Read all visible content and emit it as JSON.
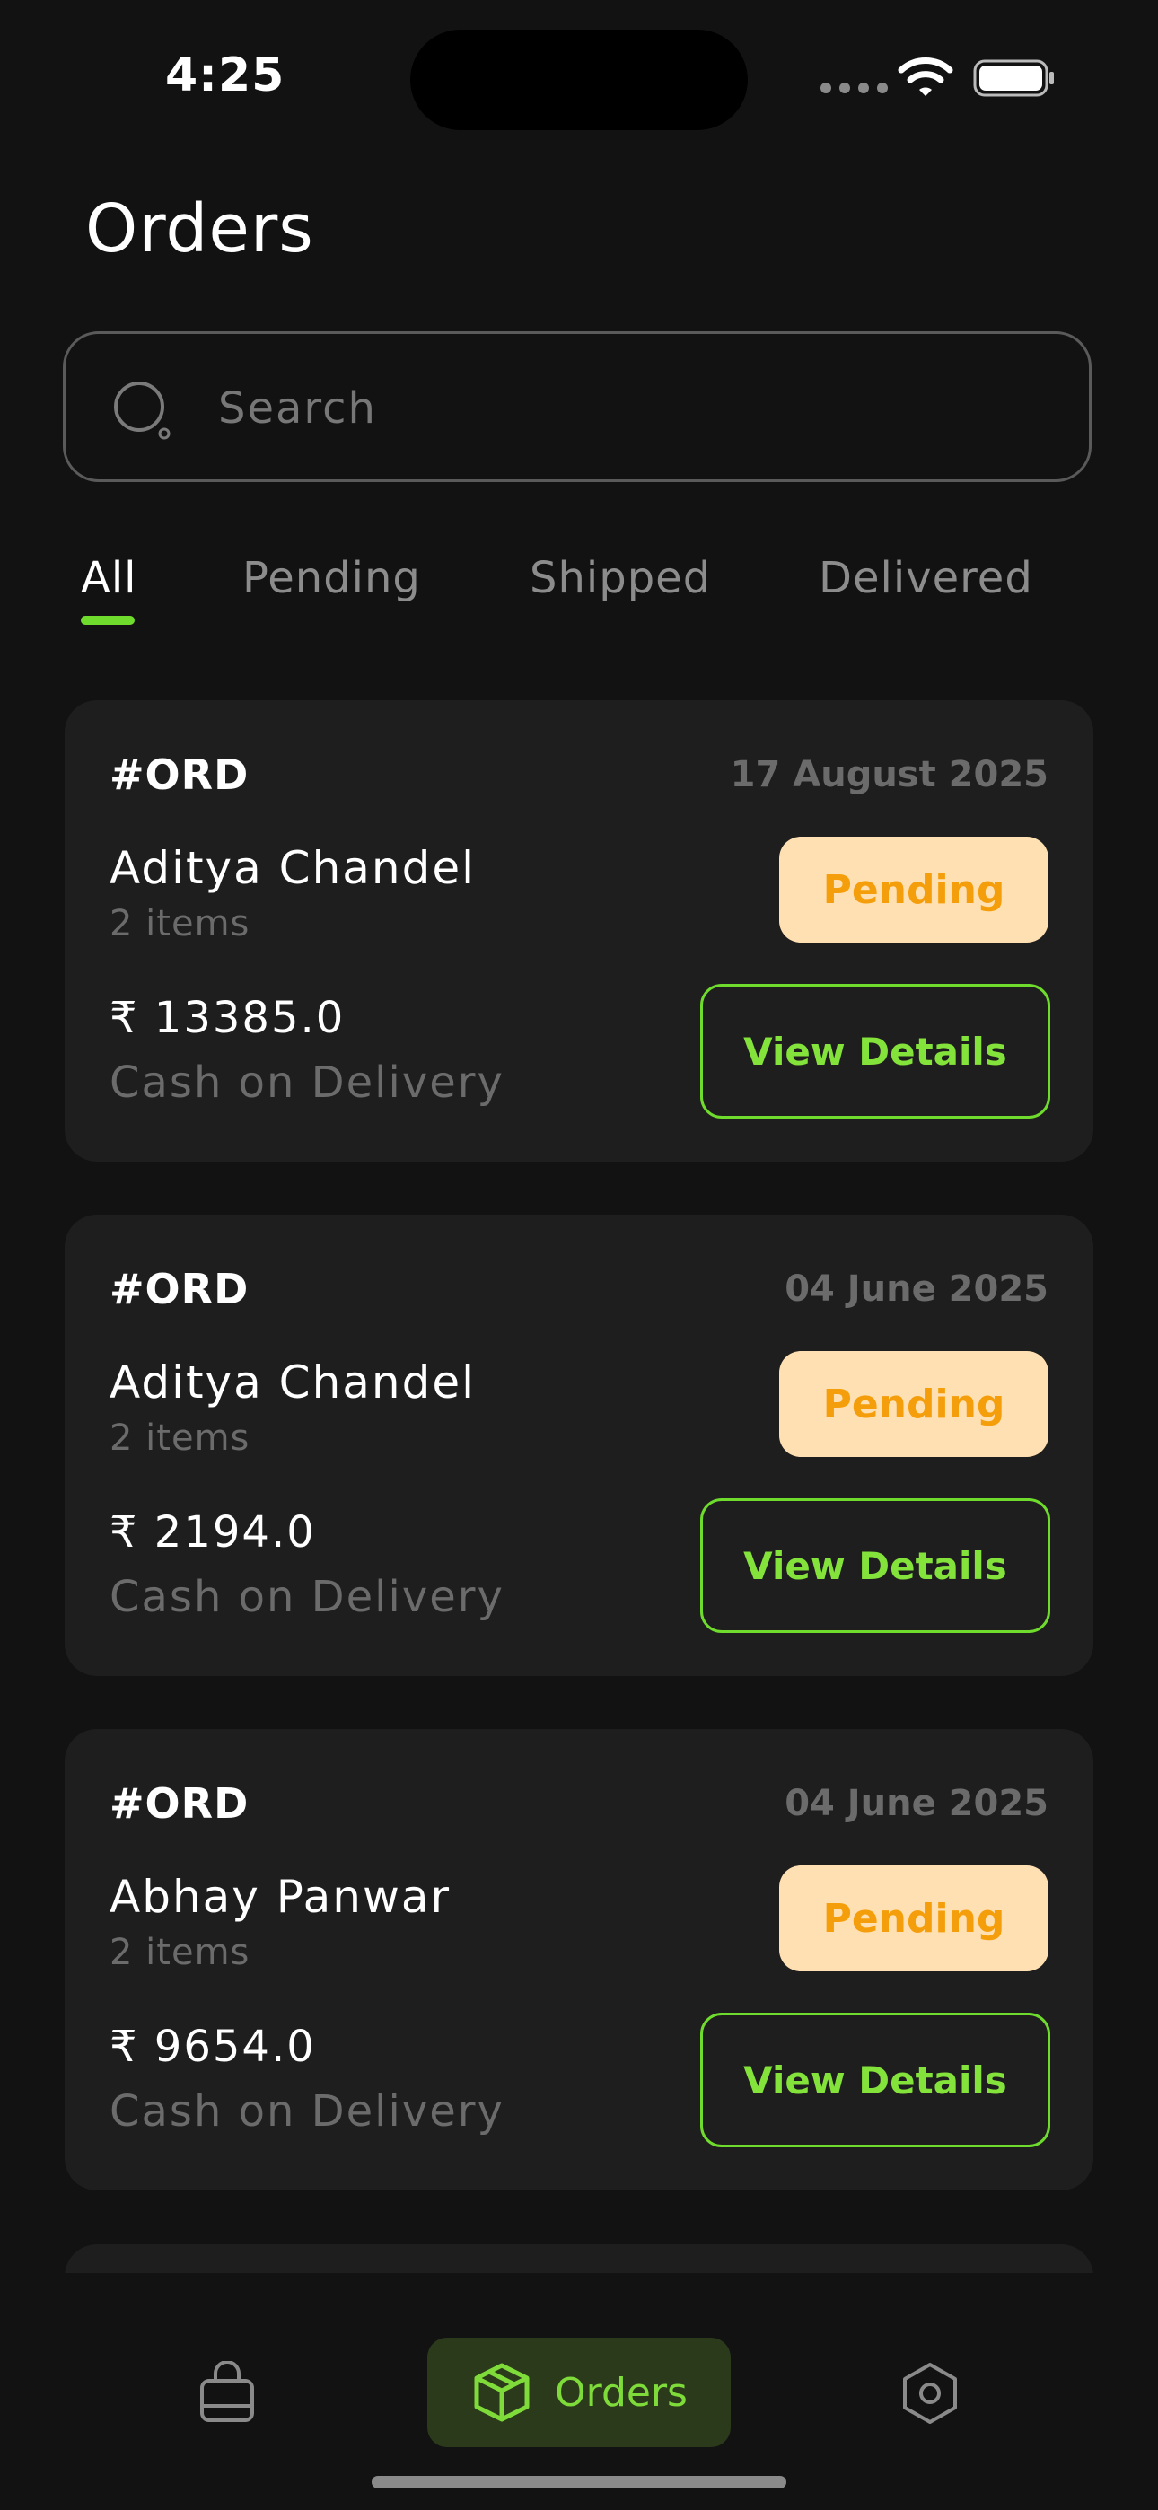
{
  "status_bar": {
    "time": "4:25"
  },
  "header": {
    "title": "Orders"
  },
  "search": {
    "placeholder": "Search"
  },
  "tabs": [
    {
      "label": "All",
      "active": true
    },
    {
      "label": "Pending",
      "active": false
    },
    {
      "label": "Shipped",
      "active": false
    },
    {
      "label": "Delivered",
      "active": false
    }
  ],
  "orders": [
    {
      "id": "#ORD",
      "date": "17 August 2025",
      "customer": "Aditya Chandel",
      "items": "2 items",
      "amount": "₹ 13385.0",
      "payment": "Cash on Delivery",
      "status": "Pending",
      "action": "View Details"
    },
    {
      "id": "#ORD",
      "date": "04 June 2025",
      "customer": "Aditya Chandel",
      "items": "2 items",
      "amount": "₹ 2194.0",
      "payment": "Cash on Delivery",
      "status": "Pending",
      "action": "View Details"
    },
    {
      "id": "#ORD",
      "date": "04 June 2025",
      "customer": "Abhay Panwar",
      "items": "2 items",
      "amount": "₹ 9654.0",
      "payment": "Cash on Delivery",
      "status": "Pending",
      "action": "View Details"
    }
  ],
  "bottom_nav": {
    "items": [
      {
        "icon": "shopping-bag-icon",
        "label": ""
      },
      {
        "icon": "package-icon",
        "label": "Orders",
        "active": true
      },
      {
        "icon": "settings-icon",
        "label": ""
      }
    ]
  },
  "colors": {
    "background": "#121212",
    "card": "#1e1e1e",
    "accent": "#6fdc2d",
    "pending_bg": "#ffe0b2",
    "pending_text": "#f59e0b"
  }
}
